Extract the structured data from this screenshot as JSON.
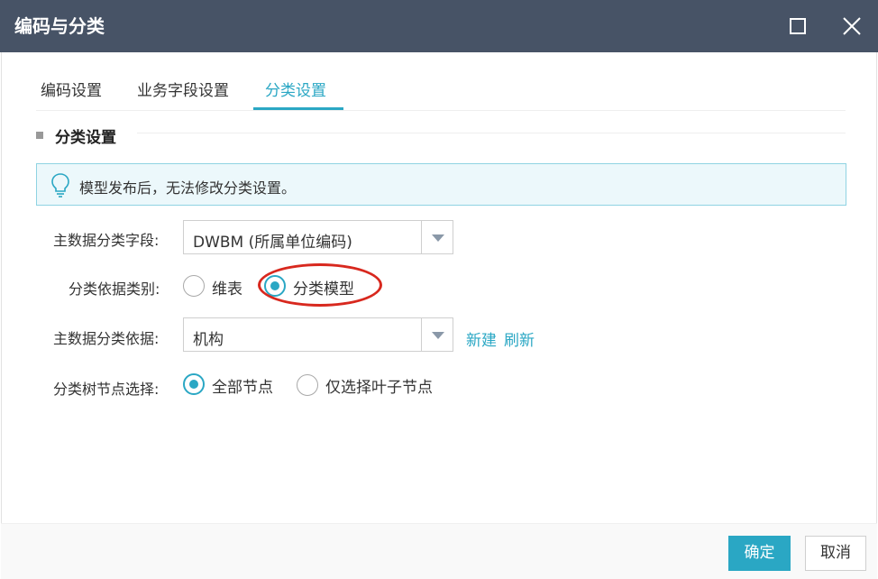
{
  "dialog": {
    "title": "编码与分类"
  },
  "tabs": [
    {
      "label": "编码设置",
      "active": false
    },
    {
      "label": "业务字段设置",
      "active": false
    },
    {
      "label": "分类设置",
      "active": true
    }
  ],
  "section": {
    "title": "分类设置"
  },
  "notice": {
    "icon": "lightbulb-icon",
    "text": "模型发布后，无法修改分类设置。"
  },
  "form": {
    "classify_field": {
      "label": "主数据分类字段:",
      "value": "DWBM (所属单位编码)"
    },
    "basis_type": {
      "label": "分类依据类别:",
      "options": [
        {
          "label": "维表",
          "checked": false
        },
        {
          "label": "分类模型",
          "checked": true
        }
      ]
    },
    "classify_basis": {
      "label": "主数据分类依据:",
      "value": "机构",
      "links": {
        "new": "新建",
        "refresh": "刷新"
      }
    },
    "tree_node_select": {
      "label": "分类树节点选择:",
      "options": [
        {
          "label": "全部节点",
          "checked": true
        },
        {
          "label": "仅选择叶子节点",
          "checked": false
        }
      ]
    }
  },
  "footer": {
    "ok_label": "确定",
    "cancel_label": "取消"
  },
  "colors": {
    "titlebar": "#475366",
    "accent": "#2aa7c4",
    "annotation": "#d8281e"
  }
}
